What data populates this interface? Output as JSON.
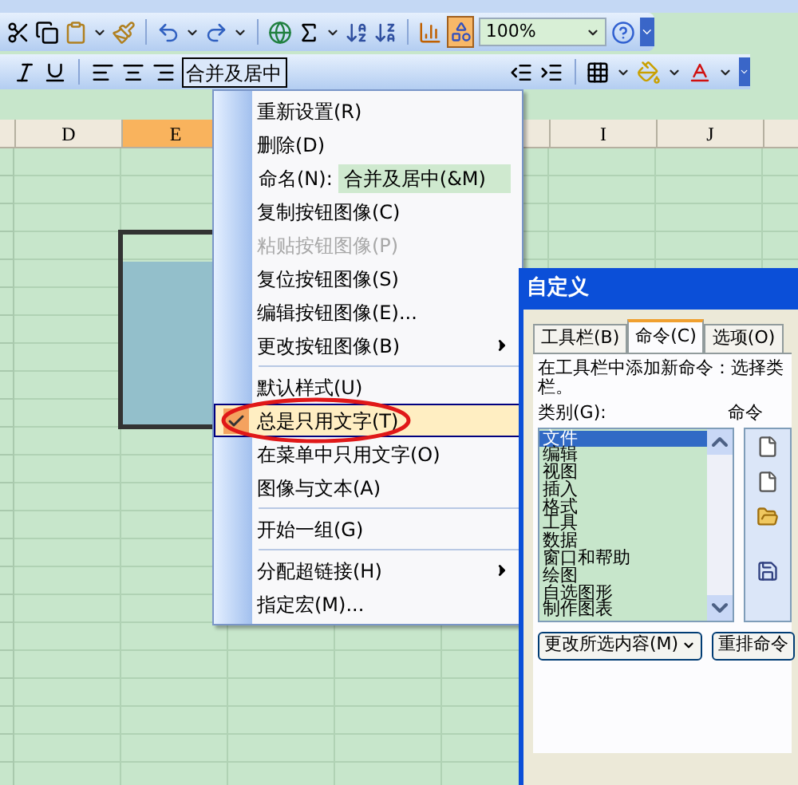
{
  "toolbar_standard": {
    "zoom": "100%"
  },
  "toolbar_formatting": {
    "merge_button": "合并及居中"
  },
  "columns": [
    {
      "kind": "column",
      "label": "D",
      "selected": false
    },
    {
      "kind": "column",
      "label": "E",
      "selected": true
    },
    {
      "kind": "hidden"
    },
    {
      "kind": "hidden"
    },
    {
      "kind": "blank"
    },
    {
      "kind": "column",
      "label": "I",
      "selected": false
    },
    {
      "kind": "column",
      "label": "J",
      "selected": false
    },
    {
      "kind": "blank"
    }
  ],
  "context_menu": {
    "items": [
      {
        "kind": "item",
        "label": "重新设置(R)",
        "disabled": false,
        "checked": false,
        "selected": false,
        "submenu": false,
        "circled": false
      },
      {
        "kind": "item",
        "label": "删除(D)",
        "disabled": false,
        "checked": false,
        "selected": false,
        "submenu": false,
        "circled": false
      },
      {
        "kind": "name_field",
        "label": "命名(N):",
        "value": "合并及居中(&M)"
      },
      {
        "kind": "item",
        "label": "复制按钮图像(C)",
        "disabled": false,
        "checked": false,
        "selected": false,
        "submenu": false,
        "circled": false
      },
      {
        "kind": "item",
        "label": "粘贴按钮图像(P)",
        "disabled": true,
        "checked": false,
        "selected": false,
        "submenu": false,
        "circled": false
      },
      {
        "kind": "item",
        "label": "复位按钮图像(S)",
        "disabled": false,
        "checked": false,
        "selected": false,
        "submenu": false,
        "circled": false
      },
      {
        "kind": "item",
        "label": "编辑按钮图像(E)...",
        "disabled": false,
        "checked": false,
        "selected": false,
        "submenu": false,
        "circled": false
      },
      {
        "kind": "item",
        "label": "更改按钮图像(B)",
        "disabled": false,
        "checked": false,
        "selected": false,
        "submenu": true,
        "circled": false
      },
      {
        "kind": "separator"
      },
      {
        "kind": "item",
        "label": "默认样式(U)",
        "disabled": false,
        "checked": false,
        "selected": false,
        "submenu": false,
        "circled": false
      },
      {
        "kind": "item",
        "label": "总是只用文字(T)",
        "disabled": false,
        "checked": true,
        "selected": true,
        "submenu": false,
        "circled": true
      },
      {
        "kind": "item",
        "label": "在菜单中只用文字(O)",
        "disabled": false,
        "checked": false,
        "selected": false,
        "submenu": false,
        "circled": false
      },
      {
        "kind": "item",
        "label": "图像与文本(A)",
        "disabled": false,
        "checked": false,
        "selected": false,
        "submenu": false,
        "circled": false
      },
      {
        "kind": "separator"
      },
      {
        "kind": "item",
        "label": "开始一组(G)",
        "disabled": false,
        "checked": false,
        "selected": false,
        "submenu": false,
        "circled": false
      },
      {
        "kind": "separator"
      },
      {
        "kind": "item",
        "label": "分配超链接(H)",
        "disabled": false,
        "checked": false,
        "selected": false,
        "submenu": true,
        "circled": false
      },
      {
        "kind": "item",
        "label": "指定宏(M)...",
        "disabled": false,
        "checked": false,
        "selected": false,
        "submenu": false,
        "circled": false
      }
    ]
  },
  "dialog": {
    "title": "自定义",
    "tabs": [
      {
        "label": "工具栏(B)",
        "selected": false
      },
      {
        "label": "命令(C)",
        "selected": true
      },
      {
        "label": "选项(O)",
        "selected": false
      }
    ],
    "description": [
      "在工具栏中添加新命令：选择类",
      "栏。"
    ],
    "categories_label": "类别(G):",
    "commands_label": "命令",
    "categories": [
      {
        "label": "文件",
        "selected": true
      },
      {
        "label": "编辑",
        "selected": false
      },
      {
        "label": "视图",
        "selected": false
      },
      {
        "label": "插入",
        "selected": false
      },
      {
        "label": "格式",
        "selected": false
      },
      {
        "label": "工具",
        "selected": false
      },
      {
        "label": "数据",
        "selected": false
      },
      {
        "label": "窗口和帮助",
        "selected": false
      },
      {
        "label": "绘图",
        "selected": false
      },
      {
        "label": "自选图形",
        "selected": false
      },
      {
        "label": "制作图表",
        "selected": false
      }
    ],
    "buttons": [
      {
        "label": "更改所选内容(M)",
        "dropdown": true
      },
      {
        "label": "重排命令",
        "dropdown": false
      }
    ]
  }
}
